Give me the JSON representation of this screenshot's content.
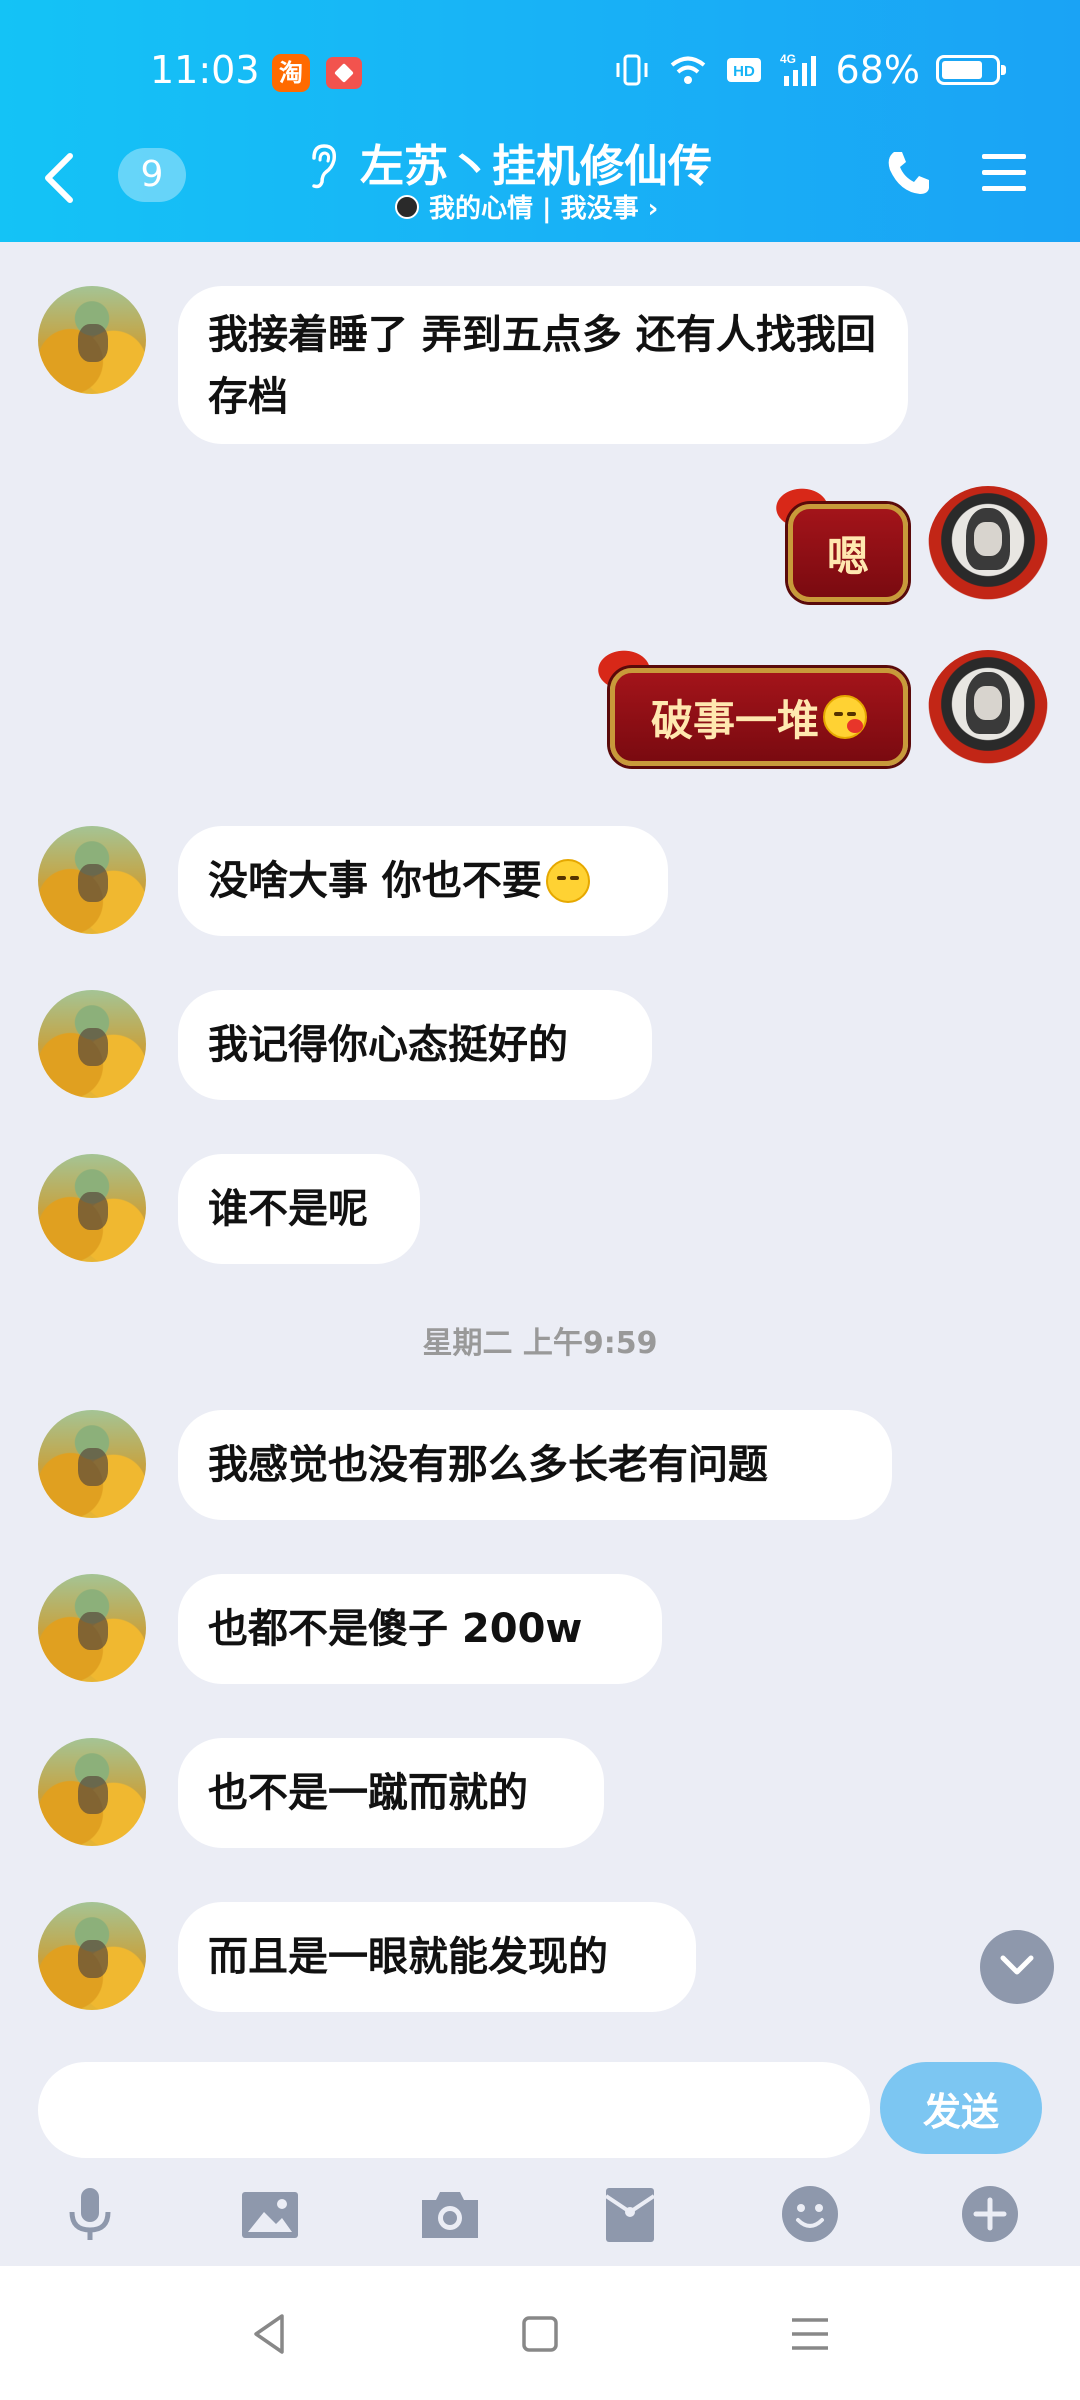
{
  "status_bar": {
    "time": "11:03",
    "app_icon_1": "淘",
    "battery": "68%",
    "icons": [
      "vibrate-icon",
      "wifi-icon",
      "hd-icon",
      "4g-signal-icon",
      "battery-icon"
    ]
  },
  "header": {
    "unread_count": "9",
    "title": "左苏丶挂机修仙传",
    "subtitle": "我的心情 | 我没事 ›",
    "colors": {
      "start": "#14C3F6",
      "end": "#1AA3F5"
    }
  },
  "messages": [
    {
      "side": "left",
      "text": "我接着睡了 弄到五点多 还有人找我回存档"
    },
    {
      "side": "right",
      "text": "嗯"
    },
    {
      "side": "right",
      "text": "破事一堆",
      "emoji": "kiss-emoji"
    },
    {
      "side": "left",
      "text": "没啥大事 你也不要",
      "emoji": "smirk-emoji"
    },
    {
      "side": "left",
      "text": "我记得你心态挺好的"
    },
    {
      "side": "left",
      "text": "谁不是呢"
    },
    {
      "side": "left",
      "text": "我感觉也没有那么多长老有问题"
    },
    {
      "side": "left",
      "text": "也都不是傻子 200w"
    },
    {
      "side": "left",
      "text": "也不是一蹴而就的"
    },
    {
      "side": "left",
      "text": "而且是一眼就能发现的"
    }
  ],
  "timestamp": "星期二 上午9:59",
  "composer": {
    "input_value": "",
    "send_label": "发送",
    "tools": [
      "microphone-icon",
      "image-icon",
      "camera-icon",
      "red-packet-icon",
      "emoji-icon",
      "plus-icon"
    ]
  },
  "navbar": {
    "buttons": [
      "back-triangle-icon",
      "home-square-icon",
      "menu-lines-icon"
    ]
  }
}
